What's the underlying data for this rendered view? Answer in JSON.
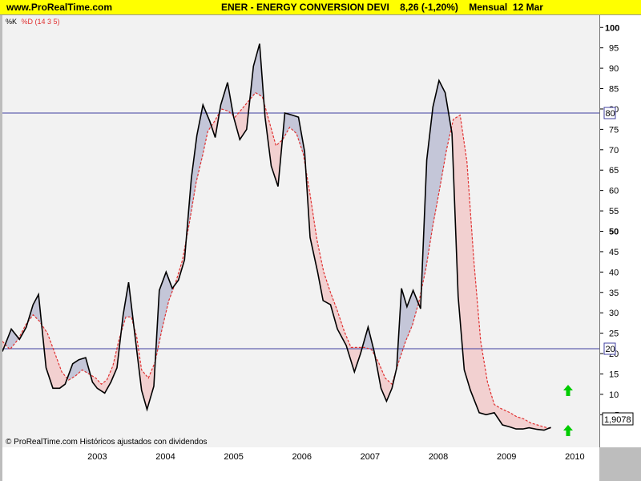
{
  "header": {
    "site": "www.ProRealTime.com",
    "title": "ENER - ENERGY CONVERSION DEVI",
    "price": "8,26 (-1,20%)",
    "period": "Mensual",
    "date": "12 Mar"
  },
  "colors": {
    "header_bg": "#ffff00",
    "k_line": "#000000",
    "d_line": "#e03030",
    "fill_k_above": "#c4c6d8",
    "fill_d_above": "#f2d0d0",
    "level_lines": "#4040a0",
    "arrow": "#00cc00"
  },
  "chart_data": {
    "type": "line",
    "indicator": "Stochastic",
    "legend": [
      "%K",
      "%D (14 3 5)"
    ],
    "ylim": [
      -3,
      103
    ],
    "yticks": [
      100,
      95,
      90,
      85,
      80,
      75,
      70,
      65,
      60,
      55,
      50,
      45,
      40,
      35,
      30,
      25,
      20,
      15,
      10,
      5
    ],
    "xlim": [
      2002.11,
      2010.86
    ],
    "xticks": [
      "2003",
      "2004",
      "2005",
      "2006",
      "2007",
      "2008",
      "2009",
      "2010"
    ],
    "levels": [
      80,
      20
    ],
    "last_value": "1,9078",
    "footer": "© ProRealTime.com  Históricos ajustados con dividendos",
    "series": [
      {
        "name": "%K",
        "x": [
          2002.11,
          2002.24,
          2002.36,
          2002.46,
          2002.56,
          2002.64,
          2002.75,
          2002.85,
          2002.95,
          2003.03,
          2003.14,
          2003.23,
          2003.33,
          2003.43,
          2003.5,
          2003.61,
          2003.7,
          2003.79,
          2003.88,
          2003.96,
          2004.06,
          2004.15,
          2004.23,
          2004.33,
          2004.41,
          2004.51,
          2004.6,
          2004.69,
          2004.78,
          2004.88,
          2004.96,
          2005.05,
          2005.15,
          2005.23,
          2005.31,
          2005.41,
          2005.5,
          2005.59,
          2005.69,
          2005.79,
          2005.88,
          2005.96,
          2006.05,
          2006.15,
          2006.25,
          2006.36,
          2006.45,
          2006.54,
          2006.62,
          2006.73,
          2006.81,
          2006.92,
          2007.02,
          2007.15,
          2007.27,
          2007.36,
          2007.47,
          2007.56,
          2007.66,
          2007.74,
          2007.82,
          2007.89,
          2007.96,
          2008.04,
          2008.13,
          2008.24,
          2008.33,
          2008.42,
          2008.51,
          2008.6,
          2008.7,
          2008.79,
          2008.88,
          2008.97,
          2009.1,
          2009.2,
          2009.32,
          2009.44,
          2009.55,
          2009.64,
          2009.74,
          2009.83,
          2009.95,
          2010.05,
          2010.15
        ],
        "values": [
          20.5,
          26,
          23.5,
          26.5,
          32,
          34.5,
          16.5,
          11.5,
          11.5,
          12.5,
          17.5,
          18.5,
          19,
          13,
          11.5,
          10.3,
          13,
          16.5,
          29.5,
          37.5,
          23.5,
          11,
          6.3,
          12,
          35.5,
          40,
          36,
          38,
          43,
          63,
          73.5,
          81,
          77,
          73,
          81,
          86.5,
          78,
          72.5,
          75,
          90.5,
          96,
          78,
          66,
          61,
          79,
          78.5,
          78,
          69.5,
          48.5,
          40,
          33,
          32,
          26,
          22,
          15.5,
          20,
          26.5,
          20.5,
          11.5,
          8.3,
          11.5,
          16.5,
          36,
          31.5,
          35.5,
          31,
          67.5,
          80.5,
          87,
          84,
          74,
          34,
          16,
          11,
          5.5,
          5,
          5.5,
          2.5,
          2,
          1.5,
          1.5,
          1.8,
          1.4,
          1.2,
          1.9
        ]
      },
      {
        "name": "%D",
        "x": [
          2002.11,
          2002.22,
          2002.34,
          2002.45,
          2002.56,
          2002.65,
          2002.77,
          2002.87,
          2002.98,
          2003.08,
          2003.18,
          2003.28,
          2003.38,
          2003.48,
          2003.56,
          2003.64,
          2003.73,
          2003.82,
          2003.92,
          2004.0,
          2004.08,
          2004.15,
          2004.25,
          2004.35,
          2004.45,
          2004.55,
          2004.65,
          2004.75,
          2004.85,
          2004.95,
          2005.05,
          2005.12,
          2005.22,
          2005.32,
          2005.42,
          2005.52,
          2005.62,
          2005.72,
          2005.82,
          2005.92,
          2006.02,
          2006.12,
          2006.22,
          2006.32,
          2006.42,
          2006.52,
          2006.62,
          2006.72,
          2006.82,
          2006.92,
          2007.02,
          2007.12,
          2007.22,
          2007.32,
          2007.42,
          2007.52,
          2007.62,
          2007.72,
          2007.82,
          2007.92,
          2008.02,
          2008.12,
          2008.22,
          2008.32,
          2008.42,
          2008.52,
          2008.62,
          2008.72,
          2008.82,
          2008.92,
          2009.02,
          2009.12,
          2009.22,
          2009.32,
          2009.42,
          2009.55,
          2009.65,
          2009.75,
          2009.85,
          2009.95,
          2010.05,
          2010.15
        ],
        "values": [
          23,
          21,
          23.5,
          27,
          29.5,
          28,
          25,
          20.5,
          15.5,
          13.5,
          14.5,
          16,
          15,
          14,
          12.5,
          13.5,
          17,
          23.5,
          29,
          29,
          24,
          16,
          14,
          18,
          26,
          33,
          37.5,
          43,
          52,
          62,
          69,
          74.5,
          77,
          80,
          79.5,
          78,
          80,
          82,
          84,
          83,
          77,
          71,
          72.5,
          75.5,
          74,
          69,
          59,
          48,
          40,
          35,
          30.5,
          25.5,
          21.5,
          21.5,
          21.5,
          21,
          18,
          14,
          12.5,
          18,
          23,
          27,
          33,
          41,
          51.5,
          60.5,
          70,
          77.5,
          78.5,
          67,
          43,
          23,
          13,
          7.5,
          6.5,
          5.5,
          4.5,
          4,
          3,
          2.5,
          2,
          1.6
        ]
      }
    ]
  }
}
